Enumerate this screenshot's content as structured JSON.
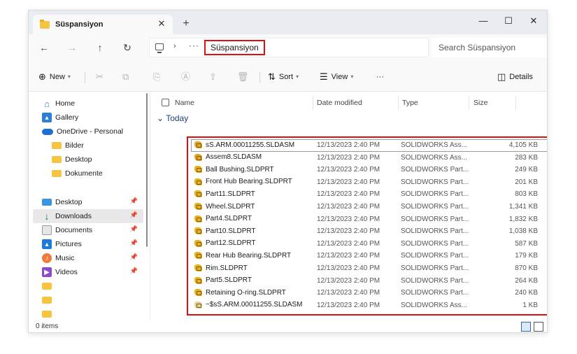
{
  "tab": {
    "title": "Süspansiyon",
    "close": "✕",
    "new": "+"
  },
  "window_controls": {
    "minimize": "—",
    "maximize": "☐",
    "close": "✕"
  },
  "nav": {
    "back": "←",
    "forward": "→",
    "up": "↑",
    "refresh": "↻"
  },
  "address": {
    "chevron": "›",
    "more": "···",
    "current": "Süspansiyon",
    "search_placeholder": "Search Süspansiyon"
  },
  "command_bar": {
    "new_label": "New",
    "sort_label": "Sort",
    "view_label": "View",
    "more": "···",
    "details_label": "Details"
  },
  "sidebar": {
    "top": [
      {
        "label": "Home",
        "icon": "home-icon"
      },
      {
        "label": "Gallery",
        "icon": "gallery-icon"
      },
      {
        "label": "OneDrive - Personal",
        "icon": "onedrive-icon"
      },
      {
        "label": "Bilder",
        "icon": "folder-icon"
      },
      {
        "label": "Desktop",
        "icon": "folder-icon"
      },
      {
        "label": "Dokumente",
        "icon": "folder-icon"
      }
    ],
    "quick": [
      {
        "label": "Desktop",
        "icon": "desktop-icon",
        "pinned": true
      },
      {
        "label": "Downloads",
        "icon": "download-icon",
        "pinned": true,
        "selected": true
      },
      {
        "label": "Documents",
        "icon": "documents-icon",
        "pinned": true
      },
      {
        "label": "Pictures",
        "icon": "pictures-icon",
        "pinned": true
      },
      {
        "label": "Music",
        "icon": "music-icon",
        "pinned": true
      },
      {
        "label": "Videos",
        "icon": "videos-icon",
        "pinned": true
      },
      {
        "label": "",
        "icon": "folder-icon"
      },
      {
        "label": "",
        "icon": "folder-icon"
      },
      {
        "label": "",
        "icon": "folder-icon"
      }
    ]
  },
  "columns": {
    "name": "Name",
    "date": "Date modified",
    "type": "Type",
    "size": "Size"
  },
  "group_label": "Today",
  "files": [
    {
      "name": "sS.ARM.00011255.SLDASM",
      "date": "12/13/2023 2:40 PM",
      "type": "SOLIDWORKS Ass...",
      "size": "4,105 KB",
      "kind": "asm"
    },
    {
      "name": "Assem8.SLDASM",
      "date": "12/13/2023 2:40 PM",
      "type": "SOLIDWORKS Ass...",
      "size": "283 KB",
      "kind": "asm"
    },
    {
      "name": "Ball Bushing.SLDPRT",
      "date": "12/13/2023 2:40 PM",
      "type": "SOLIDWORKS Part...",
      "size": "249 KB",
      "kind": "part"
    },
    {
      "name": "Front Hub Bearing.SLDPRT",
      "date": "12/13/2023 2:40 PM",
      "type": "SOLIDWORKS Part...",
      "size": "201 KB",
      "kind": "part"
    },
    {
      "name": "Part11.SLDPRT",
      "date": "12/13/2023 2:40 PM",
      "type": "SOLIDWORKS Part...",
      "size": "803 KB",
      "kind": "part"
    },
    {
      "name": "Wheel.SLDPRT",
      "date": "12/13/2023 2:40 PM",
      "type": "SOLIDWORKS Part...",
      "size": "1,341 KB",
      "kind": "part"
    },
    {
      "name": "Part4.SLDPRT",
      "date": "12/13/2023 2:40 PM",
      "type": "SOLIDWORKS Part...",
      "size": "1,832 KB",
      "kind": "part"
    },
    {
      "name": "Part10.SLDPRT",
      "date": "12/13/2023 2:40 PM",
      "type": "SOLIDWORKS Part...",
      "size": "1,038 KB",
      "kind": "part"
    },
    {
      "name": "Part12.SLDPRT",
      "date": "12/13/2023 2:40 PM",
      "type": "SOLIDWORKS Part...",
      "size": "587 KB",
      "kind": "part"
    },
    {
      "name": "Rear Hub Bearing.SLDPRT",
      "date": "12/13/2023 2:40 PM",
      "type": "SOLIDWORKS Part...",
      "size": "179 KB",
      "kind": "part"
    },
    {
      "name": "Rim.SLDPRT",
      "date": "12/13/2023 2:40 PM",
      "type": "SOLIDWORKS Part...",
      "size": "870 KB",
      "kind": "part"
    },
    {
      "name": "Part5.SLDPRT",
      "date": "12/13/2023 2:40 PM",
      "type": "SOLIDWORKS Part...",
      "size": "264 KB",
      "kind": "part"
    },
    {
      "name": "Retaining O-ring.SLDPRT",
      "date": "12/13/2023 2:40 PM",
      "type": "SOLIDWORKS Part...",
      "size": "240 KB",
      "kind": "part"
    },
    {
      "name": "~$sS.ARM.00011255.SLDASM",
      "date": "12/13/2023 2:40 PM",
      "type": "SOLIDWORKS Ass...",
      "size": "1 KB",
      "kind": "temp"
    }
  ],
  "status": {
    "items": "0 items"
  },
  "colors": {
    "highlight": "#e01010",
    "accent": "#2b6cb0",
    "folder": "#f5c542"
  }
}
